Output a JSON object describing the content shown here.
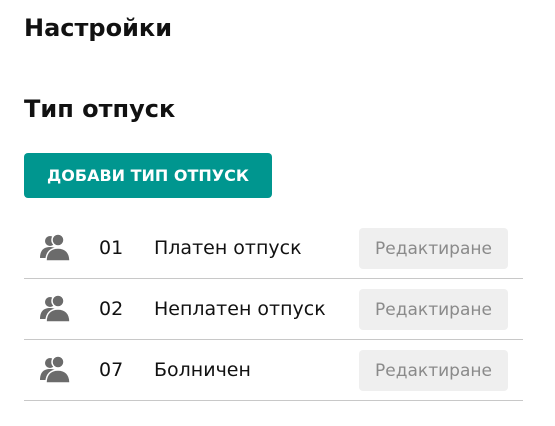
{
  "header": {
    "title": "Настройки"
  },
  "section": {
    "title": "Тип отпуск",
    "add_button_label": "ДОБАВИ ТИП ОТПУСК"
  },
  "leave_types": [
    {
      "code": "01",
      "name": "Платен отпуск",
      "edit_label": "Редактиране",
      "icon": "users-icon"
    },
    {
      "code": "02",
      "name": "Неплатен отпуск",
      "edit_label": "Редактиране",
      "icon": "users-icon"
    },
    {
      "code": "07",
      "name": "Болничен",
      "edit_label": "Редактиране",
      "icon": "users-icon"
    }
  ],
  "colors": {
    "accent": "#00968f",
    "edit_button_bg": "#efefef",
    "edit_button_text": "#8a8a8a",
    "divider": "#c8c8c8",
    "icon": "#6b6b6b"
  }
}
